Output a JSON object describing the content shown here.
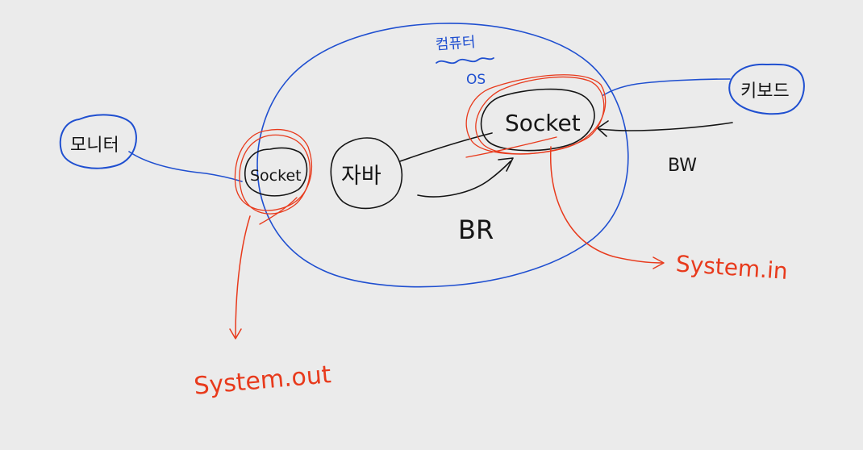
{
  "labels": {
    "computer": "컴퓨터",
    "os": "OS",
    "monitor": "모니터",
    "keyboard": "키보드",
    "java": "자바",
    "socket_left": "Socket",
    "socket_right": "Socket",
    "br": "BR",
    "bw": "BW",
    "system_in": "System.in",
    "system_out": "System.out"
  },
  "colors": {
    "background": "#ebebeb",
    "blue": "#1f4fd0",
    "black": "#151515",
    "red": "#e83a1c"
  }
}
